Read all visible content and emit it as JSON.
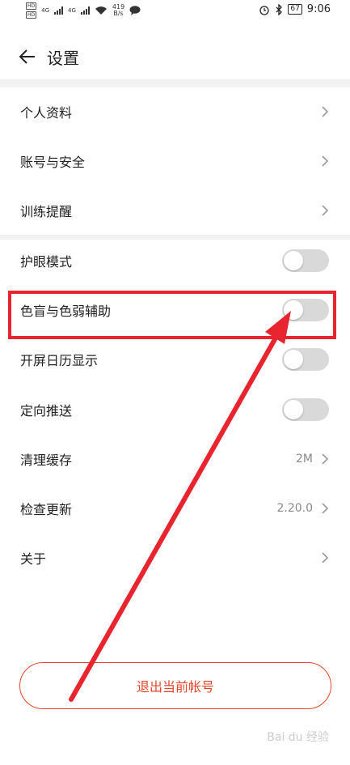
{
  "status_bar": {
    "net_speed": "419",
    "net_unit": "B/s",
    "battery": "67",
    "time": "9:06",
    "hd_badge": "HD",
    "signal_label": "4G"
  },
  "header": {
    "title": "设置"
  },
  "settings": {
    "items": [
      {
        "label": "个人资料"
      },
      {
        "label": "账号与安全"
      },
      {
        "label": "训练提醒"
      },
      {
        "label": "护眼模式",
        "toggle": false
      },
      {
        "label": "色盲与色弱辅助",
        "toggle": false
      },
      {
        "label": "开屏日历显示",
        "toggle": false
      },
      {
        "label": "定向推送",
        "toggle": false
      },
      {
        "label": "清理缓存",
        "value": "2M"
      },
      {
        "label": "检查更新",
        "value": "2.20.0"
      },
      {
        "label": "关于"
      }
    ]
  },
  "logout_label": "退出当前帐号",
  "watermark": "Bai du 经验",
  "colors": {
    "accent": "#e8452a",
    "highlight": "#e8252e",
    "toggle_off": "#d9d9d9"
  }
}
